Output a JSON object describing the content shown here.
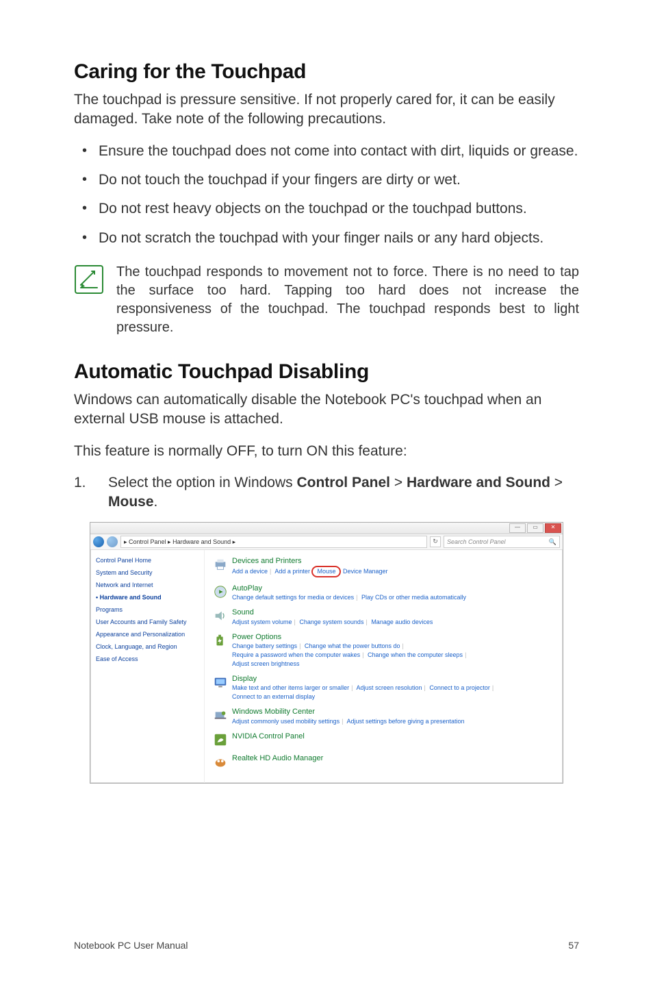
{
  "section1": {
    "title": "Caring for the Touchpad",
    "intro": "The touchpad is pressure sensitive. If not properly cared for, it can be easily damaged. Take note of the following precautions.",
    "bullets": [
      "Ensure the touchpad does not come into contact with dirt, liquids or grease.",
      "Do not touch the touchpad if your fingers are dirty or wet.",
      "Do not rest heavy objects on the touchpad or the touchpad buttons.",
      "Do not scratch the touchpad with your finger nails or any hard objects."
    ],
    "note": "The touchpad responds to movement not to force. There is no need to tap the surface too hard. Tapping too hard does not increase the responsiveness of the touchpad. The touchpad responds best to light pressure."
  },
  "section2": {
    "title": "Automatic Touchpad Disabling",
    "p1": "Windows can automatically disable the Notebook PC's touchpad when an external USB mouse is attached.",
    "p2": "This feature is normally OFF, to turn ON this feature:",
    "step1_pre": "Select the option in Windows ",
    "step1_b1": "Control Panel",
    "step1_gt1": " > ",
    "step1_b2": "Hardware and Sound",
    "step1_gt2": " > ",
    "step1_b3": "Mouse",
    "step1_post": "."
  },
  "cp": {
    "titlebar": {
      "min": "—",
      "max": "▭",
      "close": "✕"
    },
    "breadcrumb": "▸ Control Panel ▸ Hardware and Sound ▸",
    "refresh": "↻",
    "search_placeholder": "Search Control Panel",
    "search_icon": "🔍",
    "sidebar": [
      "Control Panel Home",
      "System and Security",
      "Network and Internet",
      "Hardware and Sound",
      "Programs",
      "User Accounts and Family Safety",
      "Appearance and Personalization",
      "Clock, Language, and Region",
      "Ease of Access"
    ],
    "cats": {
      "devices": {
        "title": "Devices and Printers",
        "l1": "Add a device",
        "l2": "Add a printer",
        "mouse": "Mouse",
        "l3": "Device Manager"
      },
      "autoplay": {
        "title": "AutoPlay",
        "l1": "Change default settings for media or devices",
        "l2": "Play CDs or other media automatically"
      },
      "sound": {
        "title": "Sound",
        "l1": "Adjust system volume",
        "l2": "Change system sounds",
        "l3": "Manage audio devices"
      },
      "power": {
        "title": "Power Options",
        "l1": "Change battery settings",
        "l2": "Change what the power buttons do",
        "l3": "Require a password when the computer wakes",
        "l4": "Change when the computer sleeps",
        "l5": "Adjust screen brightness"
      },
      "display": {
        "title": "Display",
        "l1": "Make text and other items larger or smaller",
        "l2": "Adjust screen resolution",
        "l3": "Connect to a projector",
        "l4": "Connect to an external display"
      },
      "mobility": {
        "title": "Windows Mobility Center",
        "l1": "Adjust commonly used mobility settings",
        "l2": "Adjust settings before giving a presentation"
      },
      "nvidia": {
        "title": "NVIDIA Control Panel"
      },
      "realtek": {
        "title": "Realtek HD Audio Manager"
      }
    }
  },
  "footer": {
    "left": "Notebook PC User Manual",
    "right": "57"
  }
}
